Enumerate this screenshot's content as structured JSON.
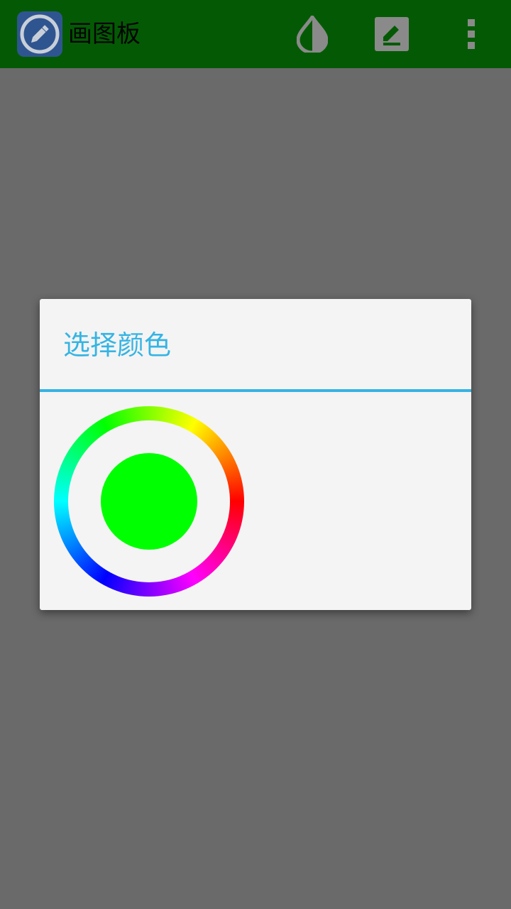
{
  "action_bar": {
    "title": "画图板",
    "background": "#045a04",
    "icons": [
      "app-pencil-icon",
      "color-drop-icon",
      "pen-edit-icon",
      "overflow-menu-icon"
    ]
  },
  "dialog": {
    "title": "选择颜色",
    "accent_color": "#35b4e3",
    "selected_color": "#00ff00"
  }
}
